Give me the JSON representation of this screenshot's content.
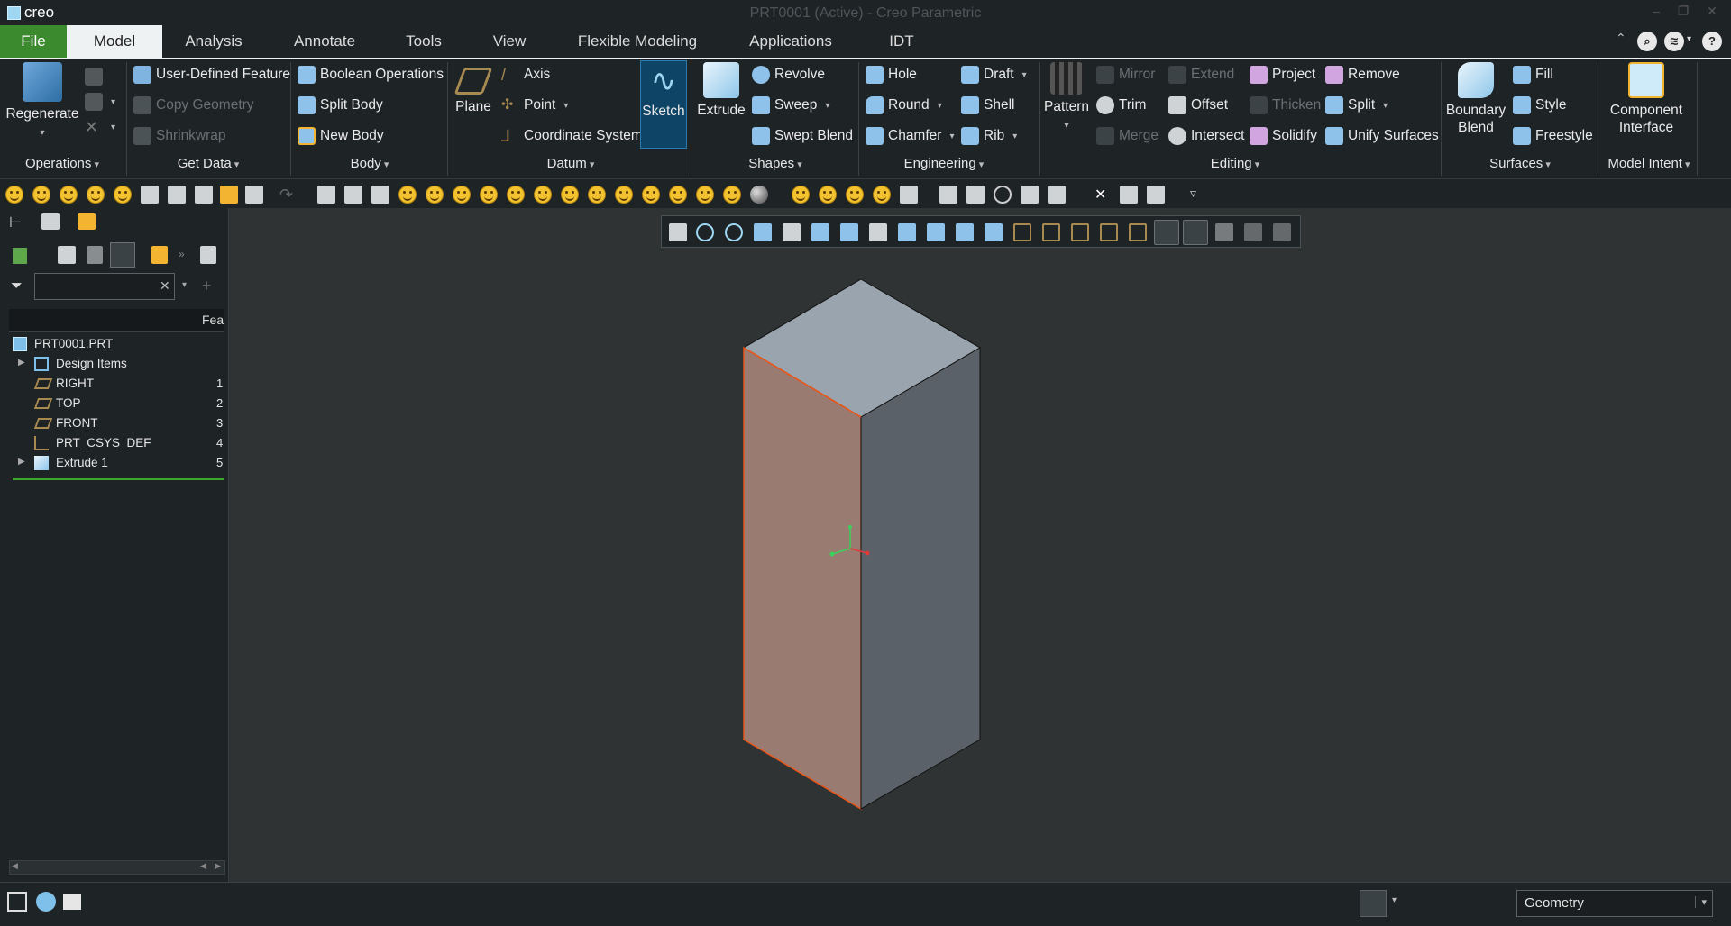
{
  "app": {
    "logo": "creo",
    "title": "PRT0001 (Active) - Creo Parametric"
  },
  "menu": {
    "tabs": [
      "File",
      "Model",
      "Analysis",
      "Annotate",
      "Tools",
      "View",
      "Flexible Modeling",
      "Applications",
      "IDT"
    ],
    "active": "Model"
  },
  "ribbon": {
    "operations": {
      "label": "Operations",
      "regenerate": "Regenerate"
    },
    "get_data": {
      "label": "Get Data",
      "udf": "User-Defined Feature",
      "copy_geometry": "Copy Geometry",
      "shrinkwrap": "Shrinkwrap"
    },
    "body": {
      "label": "Body",
      "boolean": "Boolean Operations",
      "split_body": "Split Body",
      "new_body": "New Body"
    },
    "datum": {
      "label": "Datum",
      "plane": "Plane",
      "axis": "Axis",
      "point": "Point",
      "csys": "Coordinate System",
      "sketch": "Sketch"
    },
    "shapes": {
      "label": "Shapes",
      "extrude": "Extrude",
      "revolve": "Revolve",
      "sweep": "Sweep",
      "swept_blend": "Swept Blend"
    },
    "engineering": {
      "label": "Engineering",
      "hole": "Hole",
      "round": "Round",
      "chamfer": "Chamfer",
      "draft": "Draft",
      "shell": "Shell",
      "rib": "Rib"
    },
    "editing": {
      "label": "Editing",
      "pattern": "Pattern",
      "mirror": "Mirror",
      "trim": "Trim",
      "merge": "Merge",
      "extend": "Extend",
      "offset": "Offset",
      "intersect": "Intersect",
      "project": "Project",
      "thicken": "Thicken",
      "solidify": "Solidify",
      "remove": "Remove",
      "split": "Split",
      "unify": "Unify Surfaces"
    },
    "surfaces": {
      "label": "Surfaces",
      "boundary_blend_1": "Boundary",
      "boundary_blend_2": "Blend",
      "fill": "Fill",
      "style": "Style",
      "freestyle": "Freestyle"
    },
    "model_intent": {
      "label": "Model Intent",
      "component_interface_1": "Component",
      "component_interface_2": "Interface"
    }
  },
  "tree": {
    "column_header": "Fea",
    "filter_placeholder": "",
    "root": "PRT0001.PRT",
    "items": [
      {
        "label": "Design Items",
        "num": "",
        "icon": "design-items-icon"
      },
      {
        "label": "RIGHT",
        "num": "1",
        "icon": "datum-plane-icon"
      },
      {
        "label": "TOP",
        "num": "2",
        "icon": "datum-plane-icon"
      },
      {
        "label": "FRONT",
        "num": "3",
        "icon": "datum-plane-icon"
      },
      {
        "label": "PRT_CSYS_DEF",
        "num": "4",
        "icon": "csys-icon"
      },
      {
        "label": "Extrude 1",
        "num": "5",
        "icon": "extrude-icon"
      }
    ]
  },
  "status": {
    "selection_filter": "Geometry"
  },
  "colors": {
    "accent_green": "#3b8a2e",
    "face_selected": "#9a7b72",
    "face_top": "#9aa4ae",
    "face_side": "#5b6168",
    "edge_highlight": "#e8561a"
  }
}
